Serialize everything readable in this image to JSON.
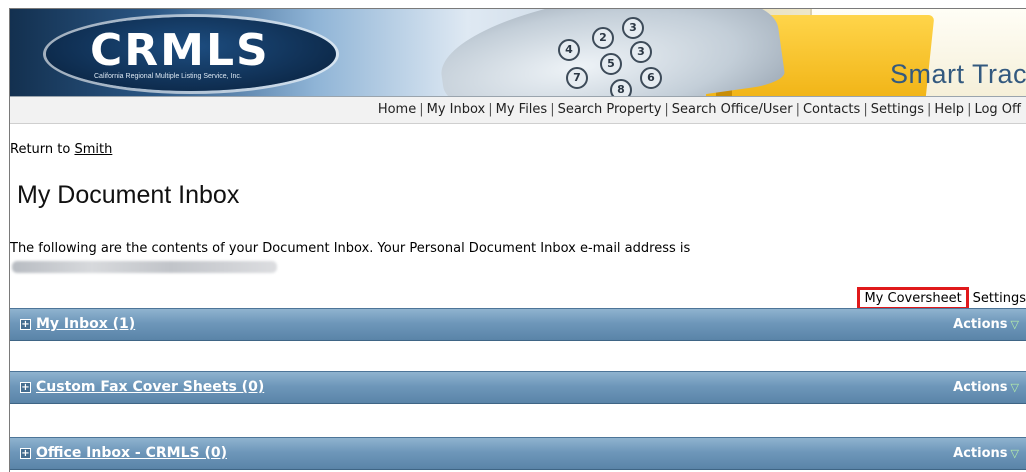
{
  "banner": {
    "logo_text": "CRMLS",
    "logo_subtitle": "California Regional Multiple Listing Service, Inc.",
    "product_name": "Smart Trac"
  },
  "nav": {
    "items": [
      "Home",
      "My Inbox",
      "My Files",
      "Search Property",
      "Search Office/User",
      "Contacts",
      "Settings",
      "Help",
      "Log Off"
    ],
    "separator": "|"
  },
  "return": {
    "prefix": "Return to",
    "link": "Smith"
  },
  "page": {
    "title": "My Document Inbox",
    "description": "The following are the contents of your Document Inbox. Your Personal Document Inbox e-mail address is"
  },
  "links": {
    "coversheet": "My Coversheet",
    "settings": "Settings"
  },
  "panels": [
    {
      "title": "My Inbox (1)",
      "actions": "Actions"
    },
    {
      "title": "Custom Fax Cover Sheets (0)",
      "actions": "Actions"
    },
    {
      "title": "Office Inbox - CRMLS (0)",
      "actions": "Actions"
    }
  ],
  "icons": {
    "expand": "plus-box-icon",
    "actions": "triangle-down-icon"
  },
  "colors": {
    "panel_blue": "#6e97ba",
    "highlight_red": "#e0191b",
    "product_text": "#33597f"
  }
}
